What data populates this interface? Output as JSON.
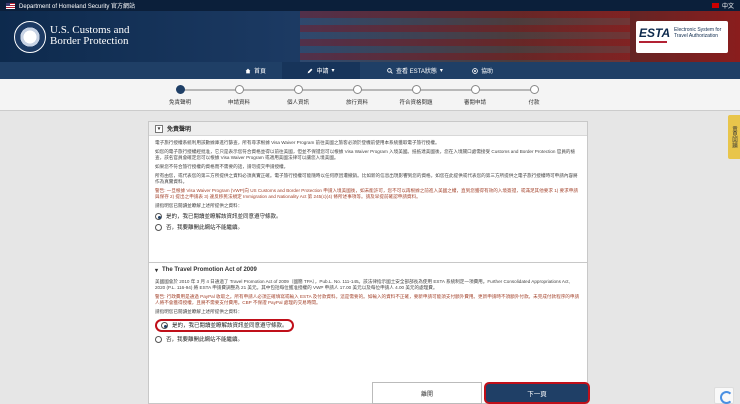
{
  "topbar": {
    "dhs": "Department of Homeland Security 官方網站",
    "lang": "中文"
  },
  "header": {
    "brand_line1": "U.S. Customs and",
    "brand_line2": "Border Protection",
    "esta": "ESTA",
    "esta_sub1": "Electronic System for",
    "esta_sub2": "Travel Authorization"
  },
  "nav": {
    "home": "首頁",
    "apply": "申請",
    "status": "查看 ESTA狀態",
    "help": "協助"
  },
  "steps": [
    "免責聲明",
    "申請資料",
    "個人資訊",
    "旅行資料",
    "符合資格問題",
    "審閱申請",
    "付款"
  ],
  "disclaimer": {
    "title": "免責聲明",
    "p1": "電子旅行授權系統利用該數據庫進行篩查，所有尋求根據 Visa Waiver Program 前往美國之旅客必須於登機前使用本系統獲取電子旅行授權。",
    "p2": "如您的電子旅行授權經批准，它只是表示您符合資格並得以前往美國，但並不保證您可以根據 Visa Waiver Program 入境美國。抵抵達美國後，您在入境關口處需接受 Customs and Border Protection 官員的檢查，該名官員會確定您可以根據 Visa Waiver Program 或適用美國法律可以讓您入境美國。",
    "p3": "如果您不符合旅行授權的資格而不需要的話，請勿提交申請授權。",
    "p4": "所有由您，或代表您的第三方所提供之資料必須真實正確。電子旅行授權可能隨時以任何原因遭撤銷。比如新的信息出現影響到您的資格。如您在此提供或代表您的第三方所提供之電子旅行授權時可申請內容將作為真實資料。",
    "warn": "警告: 一旦根據 Visa Waiver Program (VWP)向 US Customs and Border Protection 申請入境美國後，如未能許可，您不可以再根據之前進入美國之權，直到您獲得有效的入境簽證，或滿足其他要求 1) 要求申請與保存 2) 提出之申請表 3) 違反移民法規定 Immigration and Nationality Act 第 245(c)(4) 條所述事項等。請及早提前確認申請資料。",
    "prompt": "請指明您已閱讀並瞭解上述所提供之資料：",
    "opt_yes": "是的，我已閱讀並瞭解該資訊並同意遵守條款。",
    "opt_no": "否，我要離開此網站不能繼續。"
  },
  "travel_promo": {
    "title": "The Travel Promotion Act of 2009",
    "p1": "美國國會於 2010 年 3 月 4 日通過了 Travel Promotion Act of 2009（國簡 TPA），Pub.L. No. 111-145。該法律指示國土安全部部長為使用 ESTA 系統制定一項費用。Further Consolidated Appropriations Act, 2020 (P.L. 116-94) 將 ESTA 申請費調整為 21 美元。其中包括每位獲准授權的 VWP 申請人 17.00 美元以及每位申請人 4.00 美元的處理費。",
    "warn": "警告: 行政費用是通過 PayPal 收取之。所有申請人必須正確填寫或輸入 ESTA 及付款資料。這是需要的。如輸入的資料不正確，要新申請可能須支付額外費用。更新申請時不須額外付款。未完成付款程序的申請人將不會獲得授權，且將不需要支付費用。CBP 不保證 PayPal 處理的交易時間。",
    "prompt": "請指明您已閱讀並瞭解上述所提供之資料：",
    "opt_yes": "是的，我已閱讀並瞭解該資訊並同意遵守條款。",
    "opt_no": "否，我要離開此網站不能繼續。"
  },
  "buttons": {
    "back": "離開",
    "next": "下一頁"
  },
  "feedback": "意見回饋",
  "colors": {
    "navy": "#1f3f66",
    "highlight": "#c0101a",
    "warn": "#a3422b"
  }
}
